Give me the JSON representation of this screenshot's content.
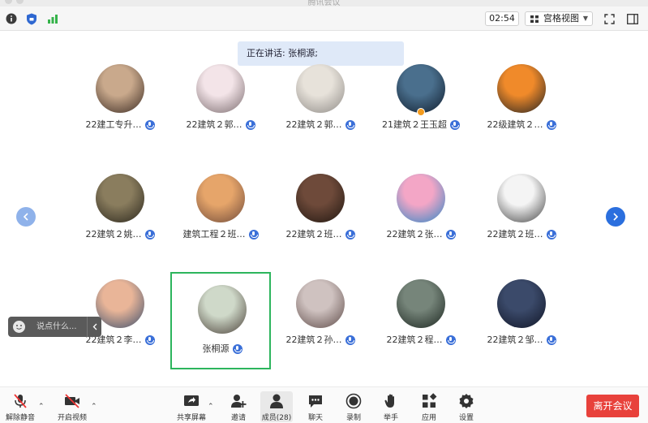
{
  "window": {
    "title": "腾讯会议"
  },
  "topbar": {
    "timer": "02:54",
    "view_label": "宫格视图"
  },
  "speaking_banner": "正在讲话: 张桐源;",
  "participants": [
    {
      "name": "22建工专升…",
      "avatar_colors": [
        "#c9a98c",
        "#3a2a22"
      ]
    },
    {
      "name": "22建筑２郭…",
      "avatar_colors": [
        "#f3e4e8",
        "#7a6b6e"
      ]
    },
    {
      "name": "22建筑２郭…",
      "avatar_colors": [
        "#e7e2da",
        "#8e8a86"
      ]
    },
    {
      "name": "21建筑２王玉超",
      "avatar_colors": [
        "#4a6f8d",
        "#0f1c2c"
      ],
      "raised_hand": true
    },
    {
      "name": "22级建筑２…",
      "avatar_colors": [
        "#f08a2a",
        "#222222"
      ]
    },
    {
      "name": "22建筑２姚…",
      "avatar_colors": [
        "#8a7d5e",
        "#2a261c"
      ]
    },
    {
      "name": "建筑工程２班…",
      "avatar_colors": [
        "#e6a56a",
        "#6f4a3a"
      ]
    },
    {
      "name": "22建筑２班…",
      "avatar_colors": [
        "#6e4a3a",
        "#1f1610"
      ]
    },
    {
      "name": "22建筑２张…",
      "avatar_colors": [
        "#f3a6c6",
        "#2e87c6"
      ]
    },
    {
      "name": "22建筑２班…",
      "avatar_colors": [
        "#f4f4f4",
        "#444444"
      ]
    },
    {
      "name": "22建筑２李…",
      "avatar_colors": [
        "#e9b598",
        "#3b4f6d"
      ]
    },
    {
      "name": "张桐源",
      "avatar_colors": [
        "#cfd9c9",
        "#4a4038"
      ],
      "active": true
    },
    {
      "name": "22建筑２孙…",
      "avatar_colors": [
        "#cfc2c0",
        "#5e4b48"
      ]
    },
    {
      "name": "22建筑２程…",
      "avatar_colors": [
        "#76857a",
        "#1c2620"
      ]
    },
    {
      "name": "22建筑２邹…",
      "avatar_colors": [
        "#3b4a6a",
        "#101526"
      ]
    }
  ],
  "chat": {
    "placeholder": "说点什么..."
  },
  "toolbar": {
    "unmute": "解除静音",
    "start_video": "开启视频",
    "share_screen": "共享屏幕",
    "invite": "邀请",
    "members": "成员(28)",
    "chat": "聊天",
    "record": "录制",
    "raise_hand": "举手",
    "apps": "应用",
    "settings": "设置",
    "leave": "离开会议"
  },
  "colors": {
    "mic_blue": "#3a6fd8",
    "active_border": "#2db55d",
    "leave_red": "#e8413b",
    "pager_left": "#8fb2ea",
    "pager_right": "#2b6fde"
  }
}
